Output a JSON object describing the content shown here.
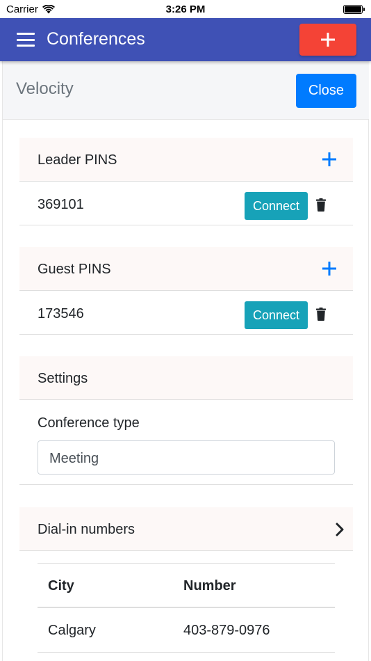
{
  "status_bar": {
    "carrier": "Carrier",
    "time": "3:26 PM"
  },
  "navbar": {
    "title": "Conferences",
    "menu_icon": "hamburger-menu-icon",
    "add_icon": "plus-icon",
    "add_color": "#f44336",
    "bar_color": "#3f51b5"
  },
  "conference": {
    "name": "Velocity",
    "close_label": "Close"
  },
  "leader_pins": {
    "label": "Leader PINS",
    "items": [
      {
        "pin": "369101",
        "connect_label": "Connect"
      }
    ]
  },
  "guest_pins": {
    "label": "Guest PINS",
    "items": [
      {
        "pin": "173546",
        "connect_label": "Connect"
      }
    ]
  },
  "settings": {
    "label": "Settings",
    "conference_type_label": "Conference type",
    "conference_type_value": "Meeting"
  },
  "dial_in": {
    "label": "Dial-in numbers",
    "columns": [
      "City",
      "Number"
    ],
    "rows": [
      {
        "city": "Calgary",
        "number": "403-879-0976"
      }
    ]
  },
  "colors": {
    "accent_blue": "#007bff",
    "connect_teal": "#17a2b8"
  }
}
